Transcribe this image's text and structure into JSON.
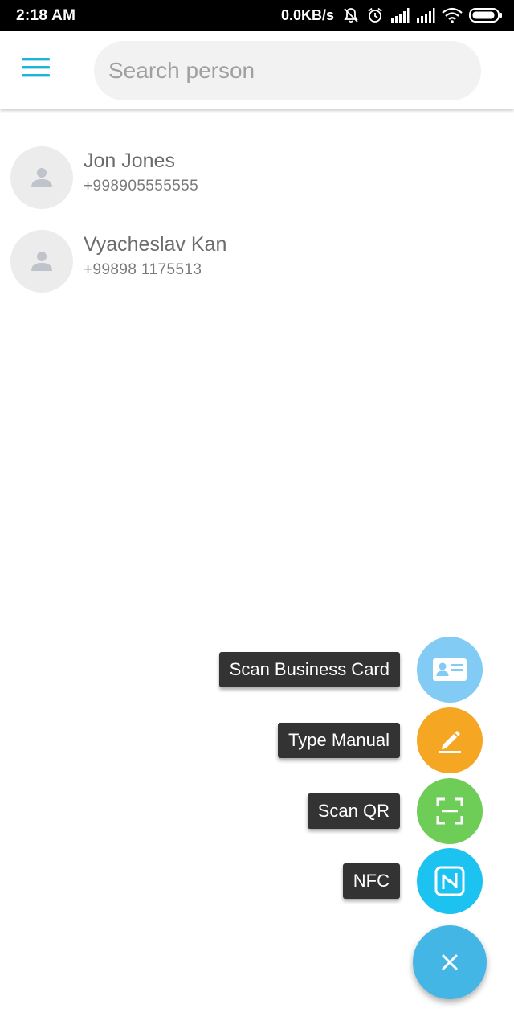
{
  "status_bar": {
    "time": "2:18 AM",
    "net_speed": "0.0KB/s",
    "icons": [
      "bell-off-icon",
      "alarm-clock-icon",
      "signal-icon",
      "signal-icon",
      "wifi-icon",
      "battery-icon"
    ]
  },
  "app_bar": {
    "menu_icon": "hamburger-menu-icon",
    "search_placeholder": "Search person",
    "search_value": ""
  },
  "contacts": [
    {
      "name": "Jon Jones",
      "phone": "+998905555555",
      "avatar_icon": "person-icon"
    },
    {
      "name": "Vyacheslav Kan",
      "phone": "+99898 1175513",
      "avatar_icon": "person-icon"
    }
  ],
  "fab": {
    "actions": [
      {
        "label": "Scan Business Card",
        "icon": "business-card-icon",
        "color": "#82cbf5"
      },
      {
        "label": "Type Manual",
        "icon": "pencil-icon",
        "color": "#f5a623"
      },
      {
        "label": "Scan QR",
        "icon": "qr-scan-icon",
        "color": "#6dcd57"
      },
      {
        "label": "NFC",
        "icon": "nfc-icon",
        "color": "#1cc3f0"
      }
    ],
    "main_icon": "close-icon",
    "main_color": "#44b6e6"
  },
  "colors": {
    "accent": "#1eb5d8",
    "avatar_bg": "#ececec",
    "label_bg": "#333333"
  }
}
